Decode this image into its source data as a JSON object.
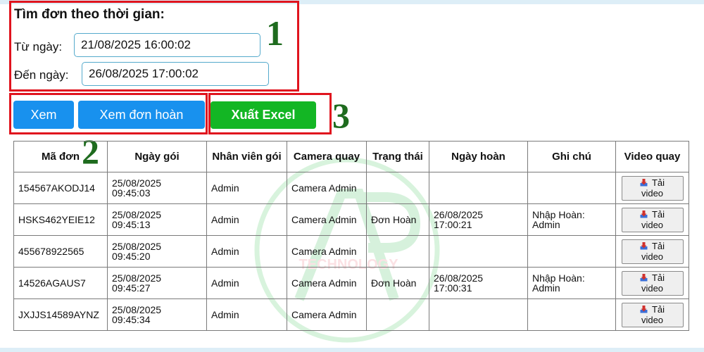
{
  "search": {
    "title": "Tìm đơn theo thời gian:",
    "from_label": "Từ ngày:",
    "from_value": "21/08/2025 16:00:02",
    "to_label": "Đến ngày:",
    "to_value": "26/08/2025 17:00:02"
  },
  "buttons": {
    "view": "Xem",
    "view_returns": "Xem đơn hoàn",
    "export_excel": "Xuất Excel"
  },
  "annotations": [
    "1",
    "2",
    "3"
  ],
  "table": {
    "headers": [
      "Mã đơn",
      "Ngày gói",
      "Nhân viên gói",
      "Camera quay",
      "Trạng thái",
      "Ngày hoàn",
      "Ghi chú",
      "Video quay"
    ],
    "download_label": "Tải video",
    "rows": [
      {
        "code": "154567AKODJ14",
        "date": "25/08/2025",
        "time": "09:45:03",
        "staff": "Admin",
        "camera": "Camera Admin",
        "status": "",
        "return_date": "",
        "return_time": "",
        "note_1": "",
        "note_2": ""
      },
      {
        "code": "HSKS462YEIE12",
        "date": "25/08/2025",
        "time": "09:45:13",
        "staff": "Admin",
        "camera": "Camera Admin",
        "status": "Đơn Hoàn",
        "return_date": "26/08/2025",
        "return_time": "17:00:21",
        "note_1": "Nhập Hoàn:",
        "note_2": "Admin"
      },
      {
        "code": "455678922565",
        "date": "25/08/2025",
        "time": "09:45:20",
        "staff": "Admin",
        "camera": "Camera Admin",
        "status": "",
        "return_date": "",
        "return_time": "",
        "note_1": "",
        "note_2": ""
      },
      {
        "code": "14526AGAUS7",
        "date": "25/08/2025",
        "time": "09:45:27",
        "staff": "Admin",
        "camera": "Camera Admin",
        "status": "Đơn Hoàn",
        "return_date": "26/08/2025",
        "return_time": "17:00:31",
        "note_1": "Nhập Hoàn:",
        "note_2": "Admin"
      },
      {
        "code": "JXJJS14589AYNZ",
        "date": "25/08/2025",
        "time": "09:45:34",
        "staff": "Admin",
        "camera": "Camera Admin",
        "status": "",
        "return_date": "",
        "return_time": "",
        "note_1": "",
        "note_2": ""
      }
    ]
  },
  "watermark": {
    "text": "TECHNOLOGY"
  },
  "colors": {
    "annotation_red": "#e0141e",
    "annotation_green": "#1e6b1e",
    "button_blue": "#1891ee",
    "button_green": "#13b624",
    "input_border": "#55aacc"
  }
}
